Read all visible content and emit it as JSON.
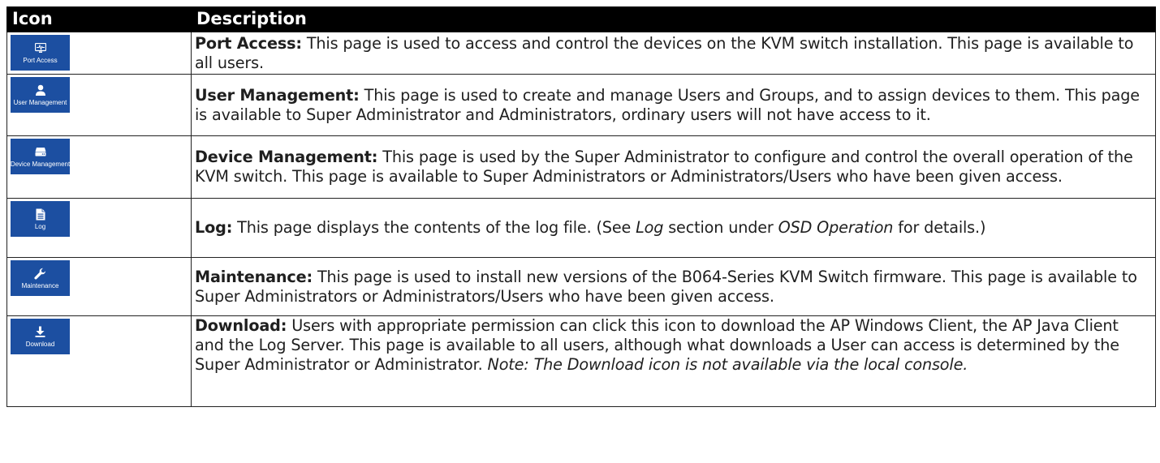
{
  "table": {
    "headers": {
      "icon": "Icon",
      "description": "Description"
    },
    "tile_color": "#1c4fa1",
    "rows": [
      {
        "icon_name": "monitor-pulse-icon",
        "tile_label": "Port Access",
        "title": "Port Access:",
        "text": " This page is used to access and control the devices on the KVM switch installation. This page is available to all users."
      },
      {
        "icon_name": "user-icon",
        "tile_label": "User Management",
        "title": "User Management:",
        "text": " This page is used to create and manage Users and Groups, and to assign devices to them. This page is available to Super Administrator and Administrators, ordinary users will not have access to it."
      },
      {
        "icon_name": "device-drive-icon",
        "tile_label": "Device Management",
        "title": "Device Management:",
        "text": " This page is used by the Super Administrator to configure and control the overall operation of the KVM switch. This page is available to Super Administrators or Administrators/Users who have been given access."
      },
      {
        "icon_name": "document-icon",
        "tile_label": "Log",
        "title": "Log:",
        "text": " This page displays the contents of the log file. (See ",
        "em1": "Log",
        "text2": " section under ",
        "em2": "OSD Operation",
        "text3": " for details.)"
      },
      {
        "icon_name": "wrench-icon",
        "tile_label": "Maintenance",
        "title": "Maintenance:",
        "text": " This page is used to install new versions of the B064-Series KVM Switch firmware. This page is available to Super Administrators or Administrators/Users who have been given access."
      },
      {
        "icon_name": "download-icon",
        "tile_label": "Download",
        "title": "Download:",
        "text": " Users with appropriate permission can click this icon to download the AP Windows Client, the AP Java Client and the Log Server. This page is available to all users, although what downloads a User can access is determined by the Super Administrator or Administrator. ",
        "note": "Note: The Download icon is not available via the local console."
      }
    ]
  }
}
